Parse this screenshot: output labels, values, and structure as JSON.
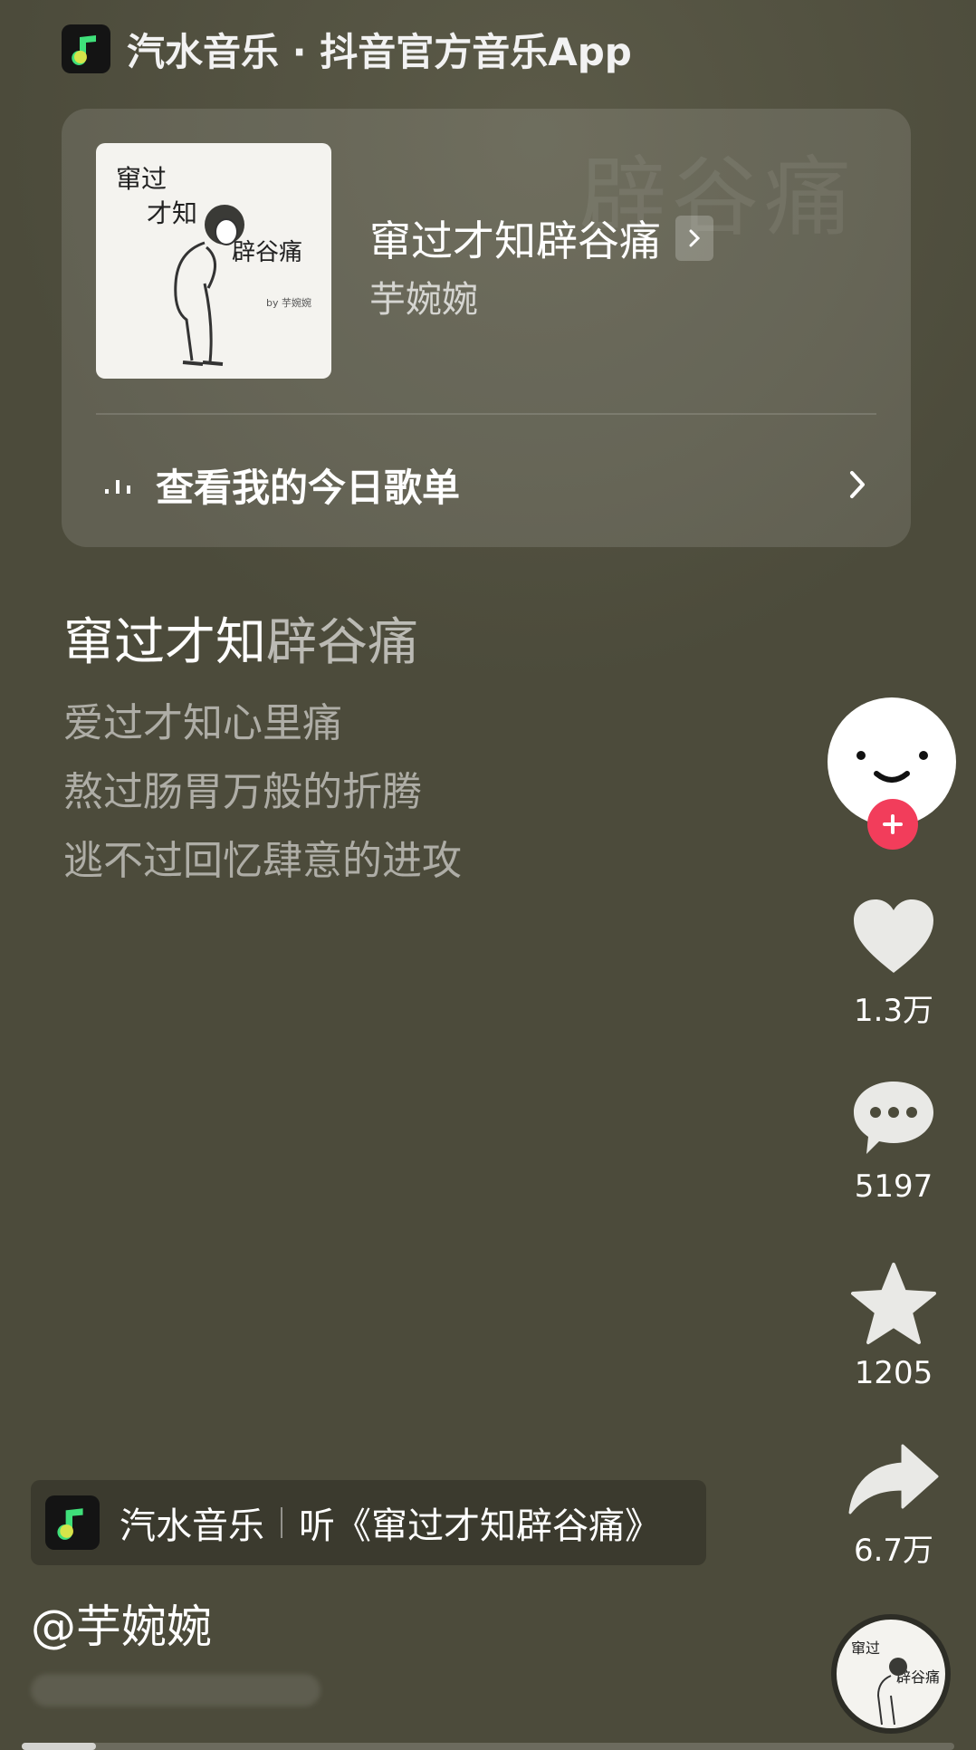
{
  "header": {
    "text": "汽水音乐 · 抖音官方音乐App",
    "logo_icon": "music-note-icon"
  },
  "card": {
    "cover": {
      "line1": "窜过",
      "line2": "才知",
      "line3": "辟谷痛",
      "by": "by 芋婉婉"
    },
    "song_title": "窜过才知辟谷痛",
    "artist": "芋婉婉",
    "playlist_label": "查看我的今日歌单",
    "playlist_icon": "audio-bars-icon"
  },
  "lyrics": {
    "title_bright": "窜过才知",
    "title_dim": "辟谷痛",
    "lines": [
      "爱过才知心里痛",
      "熬过肠胃万般的折腾",
      "逃不过回忆肆意的进攻"
    ]
  },
  "rail": {
    "like_count": "1.3万",
    "comment_count": "5197",
    "favorite_count": "1205",
    "share_count": "6.7万"
  },
  "music_tag": {
    "app_name": "汽水音乐",
    "listen_text": "听《窜过才知辟谷痛》"
  },
  "author": "@芋婉婉",
  "progress": {
    "fraction": 0.08
  },
  "colors": {
    "background": "#4c4b3b",
    "accent_follow": "#f23d5b",
    "logo_green": "#3fe07a"
  }
}
